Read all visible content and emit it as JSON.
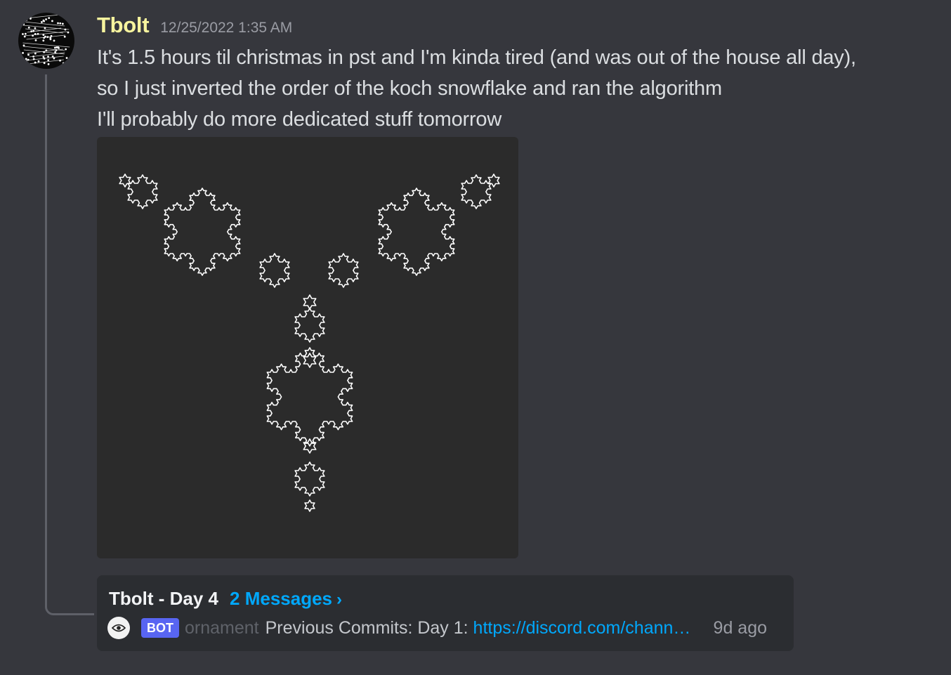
{
  "message": {
    "author": "Tbolt",
    "timestamp": "12/25/2022 1:35 AM",
    "lines": [
      "It's 1.5 hours til christmas in pst and I'm kinda tired (and was out of the house all day),",
      "so I just inverted the order of the koch snowflake and ran the algorithm",
      "I'll probably do more dedicated stuff tomorrow"
    ]
  },
  "thread": {
    "name": "Tbolt - Day 4",
    "message_count": "2 Messages",
    "chevron": "›",
    "bot_badge": "BOT",
    "bot_name": "ornament",
    "preview_text": "Previous Commits: Day 1: ",
    "preview_link": "https://discord.com/channels/...",
    "time_ago": "9d ago"
  },
  "colors": {
    "background": "#36373d",
    "username": "#f7f49e",
    "link": "#00a8fc",
    "bot_badge": "#5865f2",
    "image_bg": "#2b2b2b",
    "card_bg": "#2b2d31"
  },
  "icons": {
    "avatar": "circuit-avatar",
    "bot_avatar": "eye-icon",
    "image": "inverted-koch-fractal"
  }
}
